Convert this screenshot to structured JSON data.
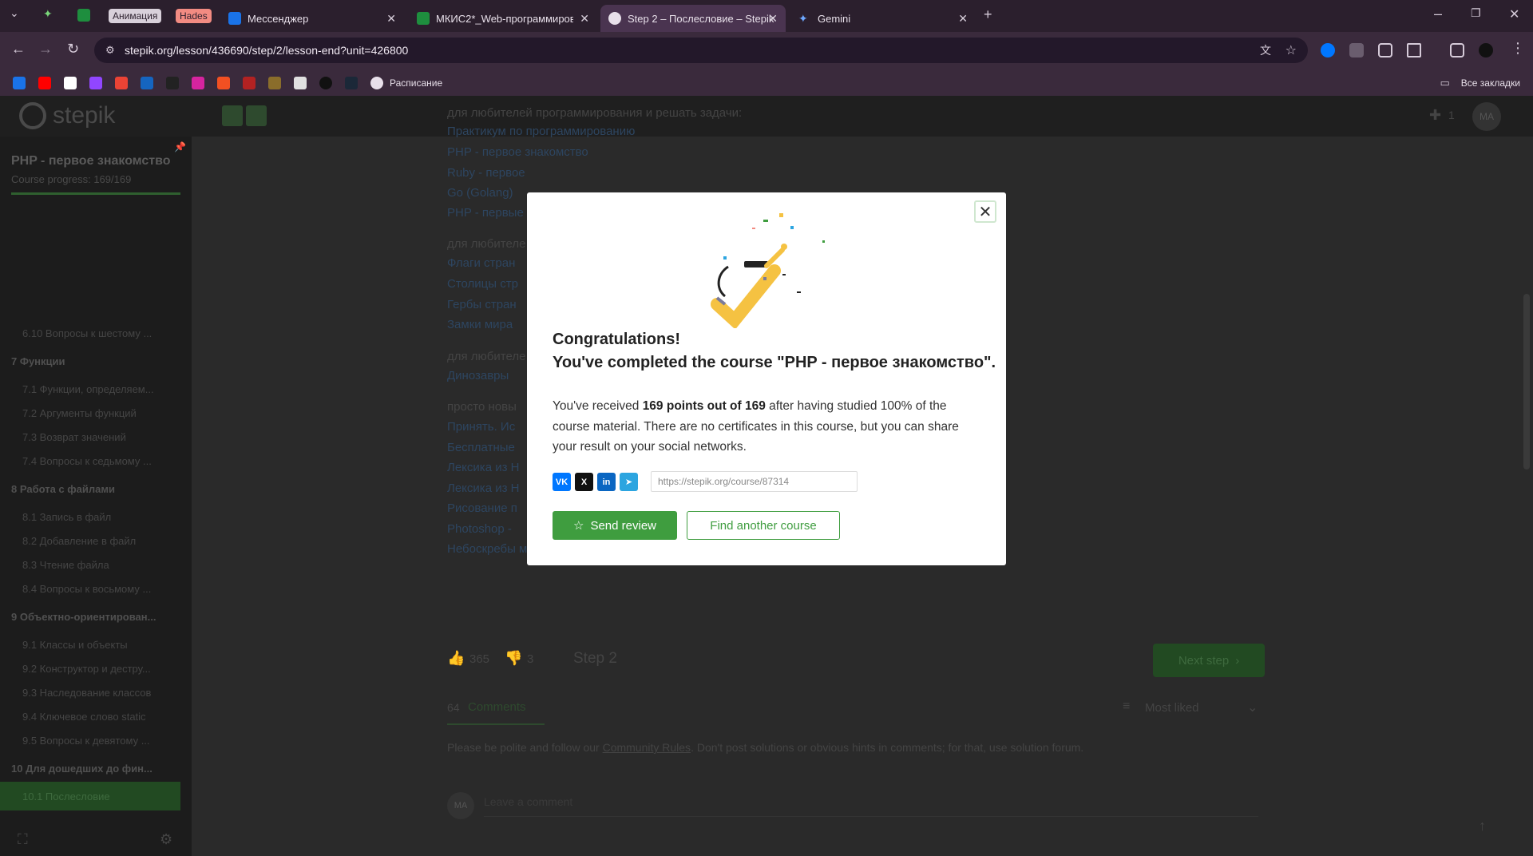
{
  "browser": {
    "tabs": [
      {
        "label": "Анимация",
        "kind": "group"
      },
      {
        "label": "Hades",
        "kind": "group"
      },
      {
        "label": "Мессенджер"
      },
      {
        "label": "МКИС2*_Web-программиров"
      },
      {
        "label": "Step 2 – Послесловие – Stepik",
        "active": true
      },
      {
        "label": "Gemini"
      }
    ],
    "url": "stepik.org/lesson/436690/step/2/lesson-end?unit=426800",
    "bookmarks_label": "Расписание",
    "all_bookmarks": "Все закладки"
  },
  "page": {
    "logo": "stepik",
    "notif_count": "1",
    "avatar": "MA",
    "sidebar": {
      "course_title": "PHP - первое знакомство",
      "progress": "Course progress: 169/169",
      "items": [
        {
          "label": "6.10  Вопросы к шестому ...",
          "type": "lesson"
        },
        {
          "label": "7  Функции",
          "type": "section"
        },
        {
          "label": "7.1  Функции, определяем...",
          "type": "lesson"
        },
        {
          "label": "7.2  Аргументы функций",
          "type": "lesson"
        },
        {
          "label": "7.3  Возврат значений",
          "type": "lesson"
        },
        {
          "label": "7.4  Вопросы к седьмому ...",
          "type": "lesson"
        },
        {
          "label": "8  Работа с файлами",
          "type": "section"
        },
        {
          "label": "8.1  Запись в файл",
          "type": "lesson"
        },
        {
          "label": "8.2  Добавление в файл",
          "type": "lesson"
        },
        {
          "label": "8.3  Чтение файла",
          "type": "lesson"
        },
        {
          "label": "8.4  Вопросы к восьмому ...",
          "type": "lesson"
        },
        {
          "label": "9  Объектно-ориентирован...",
          "type": "section"
        },
        {
          "label": "9.1  Классы и объекты",
          "type": "lesson"
        },
        {
          "label": "9.2  Конструктор и дестру...",
          "type": "lesson"
        },
        {
          "label": "9.3  Наследование классов",
          "type": "lesson"
        },
        {
          "label": "9.4  Ключевое слово static",
          "type": "lesson"
        },
        {
          "label": "9.5  Вопросы к девятому ...",
          "type": "lesson"
        },
        {
          "label": "10  Для дошедших до фин...",
          "type": "section"
        },
        {
          "label": "10.1  Послесловие",
          "type": "active"
        }
      ]
    },
    "content": {
      "line1": "для любителей программирования и решать задачи:",
      "links": [
        "Практикум по программированию",
        "PHP - первое знакомство",
        "Ruby - первое",
        "Go (Golang)",
        "PHP - первые"
      ],
      "group2": "для любителе",
      "links2": [
        "Флаги стран",
        "Столицы стр",
        "Гербы стран",
        "Замки мира"
      ],
      "group3": "для любителе",
      "links3": [
        "Динозавры"
      ],
      "group4": "просто новы",
      "links4": [
        "Принять. Ис",
        "Бесплатные",
        "Лексика из Н",
        "Лексика из Н",
        "Рисование п",
        "Photoshop -",
        "Небоскребы мира"
      ],
      "likes": "365",
      "dislikes": "3",
      "step": "Step 2",
      "next": "Next step",
      "comments_count": "64",
      "comments": "Comments",
      "sort": "Most liked",
      "rules_pre": "Please be polite and follow our ",
      "rules_link": "Community Rules",
      "rules_post": ". Don't post solutions or obvious hints in comments; for that, use solution forum.",
      "comment_placeholder": "Leave a comment"
    }
  },
  "modal": {
    "title": "Congratulations!",
    "subtitle": "You've completed the course \"PHP - первое знакомство\".",
    "text_pre": "You've received ",
    "text_bold": "169 points out of 169",
    "text_post": " after having studied 100% of the course material. There are no certificates in this course, but you can share your result on your social networks.",
    "share_url": "https://stepik.org/course/87314",
    "send_review": "Send review",
    "find_course": "Find another course",
    "share": [
      {
        "name": "vk-icon",
        "glyph": "VK",
        "color": "#0077ff"
      },
      {
        "name": "x-icon",
        "glyph": "X",
        "color": "#111111"
      },
      {
        "name": "linkedin-icon",
        "glyph": "in",
        "color": "#0a66c2"
      },
      {
        "name": "telegram-icon",
        "glyph": "➤",
        "color": "#2ca5e0"
      }
    ]
  }
}
